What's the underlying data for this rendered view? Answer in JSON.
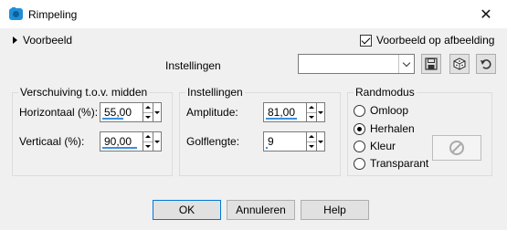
{
  "window": {
    "title": "Rimpeling",
    "close_glyph": "✕"
  },
  "preview": {
    "toggle_label": "Voorbeeld",
    "on_image_label": "Voorbeeld op afbeelding",
    "on_image_checked": true
  },
  "presets": {
    "label": "Instellingen",
    "value": ""
  },
  "offset_group": {
    "title": "Verschuiving t.o.v. midden",
    "horizontal_label": "Horizontaal (%):",
    "horizontal_value": "55,00",
    "horizontal_fraction": 0.55,
    "vertical_label": "Verticaal (%):",
    "vertical_value": "90,00",
    "vertical_fraction": 0.9
  },
  "settings_group": {
    "title": "Instellingen",
    "amplitude_label": "Amplitude:",
    "amplitude_value": "81,00",
    "amplitude_fraction": 0.81,
    "wavelength_label": "Golflengte:",
    "wavelength_value": "9",
    "wavelength_fraction": 0.05
  },
  "edge_group": {
    "title": "Randmodus",
    "options": [
      "Omloop",
      "Herhalen",
      "Kleur",
      "Transparant"
    ],
    "selected": "Herhalen"
  },
  "buttons": {
    "ok": "OK",
    "cancel": "Annuleren",
    "help": "Help"
  },
  "colors": {
    "accent": "#0078d7",
    "slider_bar": "#3c8fdc",
    "background": "#f0f0f0"
  },
  "icons": {
    "app": "app-icon",
    "save": "save-icon",
    "random": "dice-icon",
    "reset": "reset-arrow-icon",
    "no_color": "no-color-icon"
  }
}
